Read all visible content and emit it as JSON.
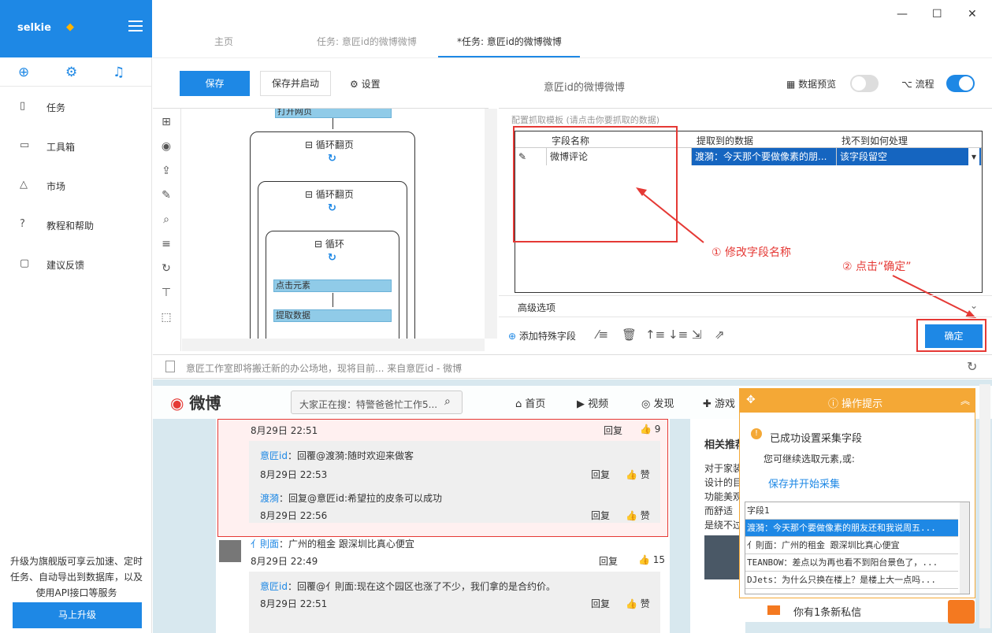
{
  "app": {
    "name": "selkie",
    "upgrade_promo": "升级为旗舰版可享云加速、定时任务、自动导出到数据库，以及使用API接口等服务",
    "upgrade_button": "马上升级"
  },
  "sidebar": {
    "items": [
      {
        "label": "任务",
        "icon": "file-icon"
      },
      {
        "label": "工具箱",
        "icon": "toolbox-icon"
      },
      {
        "label": "市场",
        "icon": "bag-icon"
      },
      {
        "label": "教程和帮助",
        "icon": "help-icon"
      },
      {
        "label": "建议反馈",
        "icon": "feedback-icon"
      }
    ]
  },
  "tabs": [
    {
      "label": "主页"
    },
    {
      "label": "任务: 意匠id的微博微博"
    },
    {
      "label": "*任务: 意匠id的微博微博"
    }
  ],
  "toolbar": {
    "save": "保存",
    "save_run": "保存并启动",
    "settings": "设置",
    "task_title": "意匠id的微博微博",
    "data_preview": "数据预览",
    "flow": "流程",
    "data_preview_on": false,
    "flow_on": true
  },
  "flow": {
    "open_page": "打开网页",
    "loop1": "循环翻页",
    "loop2": "循环翻页",
    "loop3": "循环",
    "click": "点击元素",
    "extract": "提取数据"
  },
  "extract_panel": {
    "hint": "配置抓取模板 (请点击你要抓取的数据)",
    "columns": [
      "字段名称",
      "提取到的数据",
      "找不到如何处理"
    ],
    "row": {
      "name": "微博评论",
      "value": "渡漪：今天那个要做像素的朋...",
      "missing": "该字段留空"
    },
    "annotation1": "① 修改字段名称",
    "annotation2": "② 点击“确定”",
    "advanced": "高级选项",
    "add_special": "添加特殊字段",
    "confirm": "确定"
  },
  "url": "意匠工作室即将搬迁新的办公场地，现将目前... 来自意匠id - 微博",
  "weibo": {
    "logo": "微博",
    "search": "大家正在搜：特警爸爸忙工作5...",
    "nav": [
      "首页",
      "视频",
      "发现",
      "游戏"
    ],
    "side_title": "相关推荐",
    "side_lines": [
      "对于家装",
      "设计的目",
      "功能美观",
      "而舒适",
      "是绕不过"
    ],
    "comments": [
      {
        "time": "8月29日 22:51",
        "reply": "回复",
        "likes": "9"
      },
      {
        "user": "意匠id",
        "text": "：回覆@渡漪:随时欢迎来做客",
        "time": "8月29日 22:53",
        "reply": "回复",
        "likes": "赞"
      },
      {
        "user": "渡漪",
        "text": "：回复@意匠id:希望拉的皮条可以成功",
        "time": "8月29日 22:56",
        "reply": "回复",
        "likes": "赞"
      },
      {
        "user": "亻則面",
        "text": "：广州的租金 跟深圳比真心便宜",
        "time": "8月29日 22:49",
        "reply": "回复",
        "likes": "15"
      },
      {
        "user": "意匠id",
        "text": "：回覆@亻則面:现在这个园区也涨了不少，我们拿的是合约价。",
        "time": "8月29日 22:51",
        "reply": "回复",
        "likes": "赞"
      }
    ]
  },
  "tip": {
    "title": "操作提示",
    "success": "已成功设置采集字段",
    "sub": "您可继续选取元素,或:",
    "link": "保存并开始采集",
    "list": [
      "字段1",
      "渡漪：今天那个要做像素的朋友还和我说周五...",
      "亻則面：广州的租金 跟深圳比真心便宜",
      "TEANBOW：差点以为再也看不到阳台景色了，...",
      "DJets：为什么只换在楼上？是楼上大一点吗..."
    ],
    "message": "你有1条新私信"
  },
  "colors": {
    "accent": "#1e88e5",
    "annotation": "#e53935",
    "tip": "#f4a836"
  }
}
